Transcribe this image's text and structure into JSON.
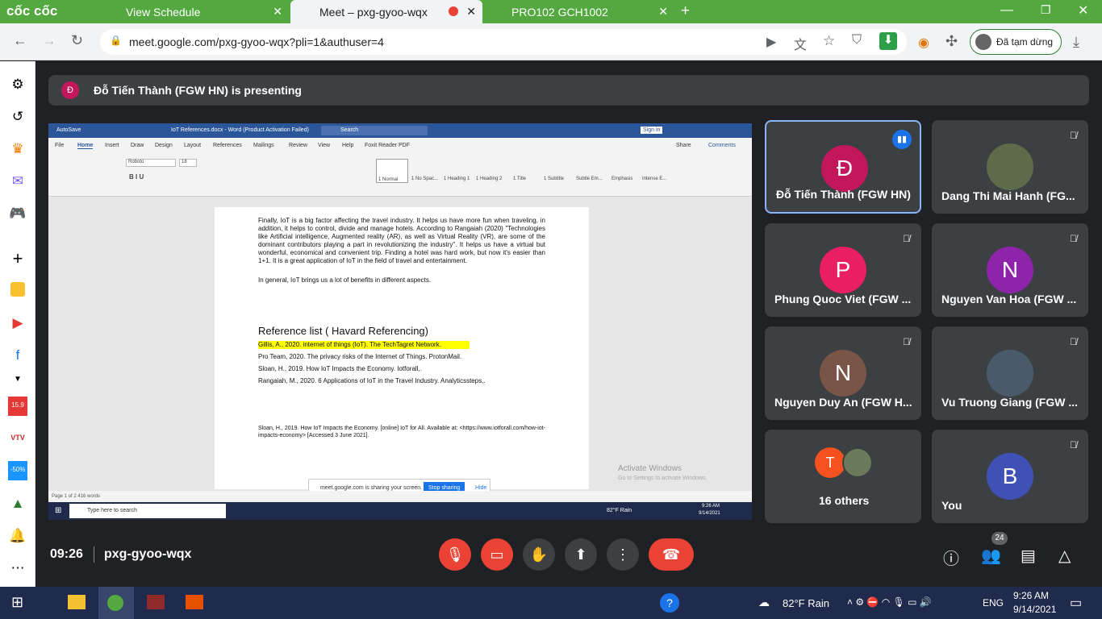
{
  "browser": {
    "tabs": [
      {
        "label": "View Schedule"
      },
      {
        "label": "Meet – pxg-gyoo-wqx"
      },
      {
        "label": "PRO102 GCH1002"
      }
    ],
    "brand": "cốc cốc",
    "url": "meet.google.com/pxg-gyoo-wqx?pli=1&authuser=4",
    "profile_label": "Đã tạm dừng"
  },
  "meet": {
    "presenter_banner": "Đỗ Tiến Thành (FGW HN) is presenting",
    "presenter_initial": "Đ",
    "time": "09:26",
    "meeting_code": "pxg-gyoo-wqx",
    "people_count": "24",
    "participants": [
      {
        "name": "Đỗ Tiến Thành (FGW HN)",
        "initial": "Đ",
        "color": "#c2185b"
      },
      {
        "name": "Dang Thi Mai Hanh (FG...",
        "initial": "",
        "color": "#5d6b4a"
      },
      {
        "name": "Phung Quoc Viet (FGW ...",
        "initial": "P",
        "color": "#e91e63"
      },
      {
        "name": "Nguyen Van Hoa (FGW ...",
        "initial": "N",
        "color": "#8e24aa"
      },
      {
        "name": "Nguyen Duy An (FGW H...",
        "initial": "N",
        "color": "#795548"
      },
      {
        "name": "Vu Truong Giang (FGW ...",
        "initial": "",
        "color": "#4a5a6a"
      },
      {
        "name": "16 others",
        "initial": "T",
        "color": "#f4511e"
      },
      {
        "name": "You",
        "initial": "B",
        "color": "#3f51b5"
      }
    ]
  },
  "word": {
    "title": "IoT References.docx - Word (Product Activation Failed)",
    "autosave": "AutoSave",
    "search": "Search",
    "signin": "Sign in",
    "tabs": [
      "File",
      "Home",
      "Insert",
      "Draw",
      "Design",
      "Layout",
      "References",
      "Mailings",
      "Review",
      "View",
      "Help",
      "Foxit Reader PDF"
    ],
    "share": "Share",
    "comments": "Comments",
    "font": "Roboto",
    "size": "18",
    "styles": [
      "1 Normal",
      "1 No Spac...",
      "1 Heading 1",
      "1 Heading 2",
      "1 Title",
      "1 Subtitle",
      "Subtle Em...",
      "Emphasis",
      "Intense E..."
    ],
    "para1": "Finally, IoT is a big factor affecting the travel industry. It helps us have more fun when traveling, in addition, it helps to control, divide and manage hotels. According to Rangaiah (2020) \"Technologies like Artificial intelligence, Augmented reality (AR), as well as Virtual Reality (VR), are some of the dominant contributors playing a part in revolutionizing the industry\". It helps us have a virtual but wonderful, economical and convenient trip. Finding a hotel was hard work, but now it's easier than 1+1. It is a great application of IoT in the field of travel and entertainment.",
    "para2": "In general, IoT brings us a lot of benefits in different aspects.",
    "ref_heading": "Reference list ( Havard Referencing)",
    "refs": [
      "Gillis, A., 2020. internet of things (IoT). The TechTagret Network.",
      "Pro Team, 2020. The privacy risks of the Internet of Things. ProtonMail.",
      "Sloan, H., 2019. How IoT Impacts the Economy. Iotforall,.",
      "Rangaiah, M., 2020. 6 Applications of IoT in the Travel Industry. Analyticssteps,."
    ],
    "footnote": "Sloan, H., 2019. How IoT Impacts the Economy. [online] IoT for All. Available at: <https://www.iotforall.com/how-iot-impacts-economy> [Accessed 3 June 2021].",
    "status": "Page 1 of 2   416 words",
    "sharing": "meet.google.com is sharing your screen.",
    "stop_sharing": "Stop sharing",
    "hide": "Hide",
    "activate": "Activate Windows",
    "activate_sub": "Go to Settings to activate Windows.",
    "taskbar_search": "Type here to search",
    "weather": "82°F Rain",
    "clock_time": "9:26 AM",
    "clock_date": "9/14/2021"
  },
  "taskbar": {
    "weather": "82°F  Rain",
    "lang": "ENG",
    "time": "9:26 AM",
    "date": "9/14/2021"
  }
}
